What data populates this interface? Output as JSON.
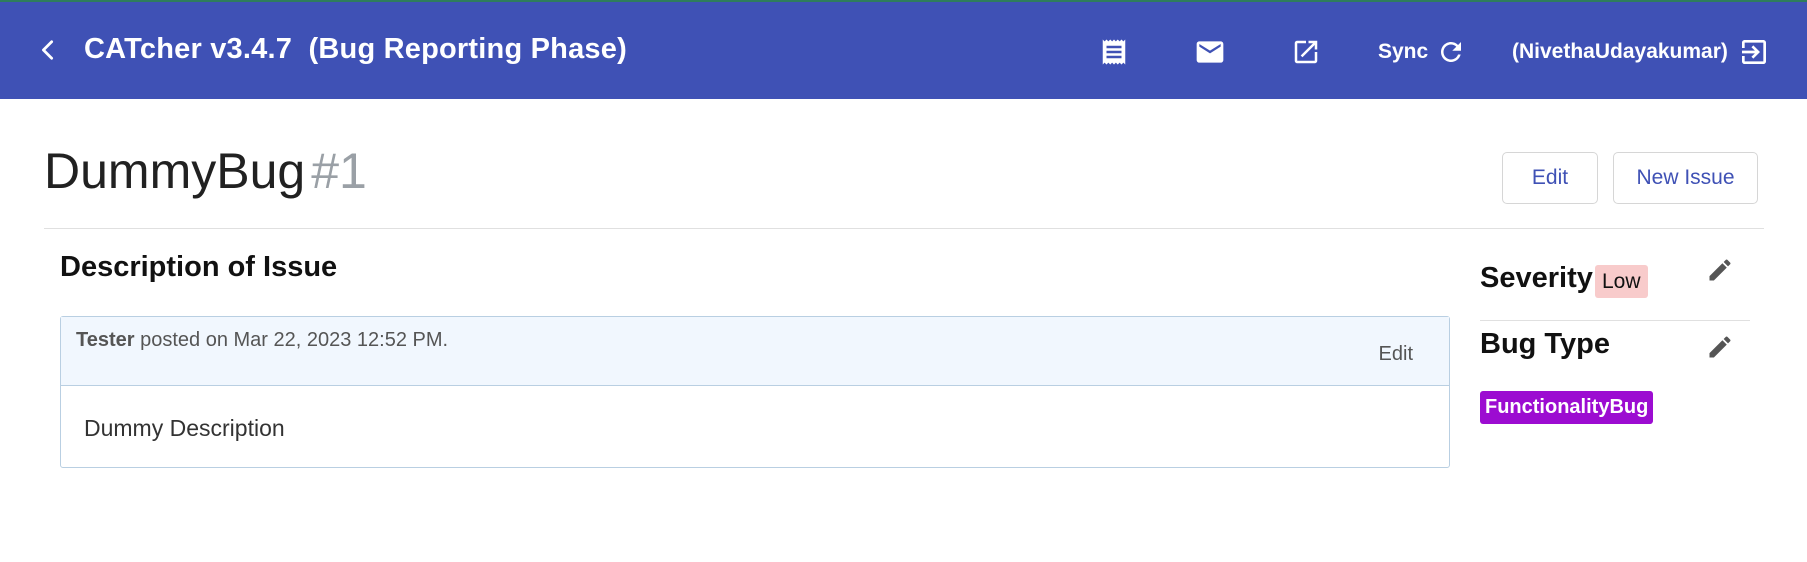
{
  "header": {
    "app_title": "CATcher v3.4.7  (Bug Reporting Phase)",
    "icons": [
      "back-arrow-icon",
      "receipt-icon",
      "mail-icon",
      "open-in-new-icon",
      "refresh-icon",
      "logout-icon"
    ],
    "sync_label": "Sync",
    "user_label": "(NivethaUdayakumar)",
    "bg_color": "#3f51b5"
  },
  "issue": {
    "title": "DummyBug",
    "number": "#1",
    "edit_label": "Edit",
    "new_issue_label": "New Issue"
  },
  "description": {
    "heading": "Description of Issue",
    "author": "Tester",
    "posted_text": " posted on Mar 22, 2023 12:52 PM.",
    "edit_label": "Edit",
    "body": "Dummy Description"
  },
  "sidebar": {
    "severity_label": "Severity",
    "severity_value": "Low",
    "severity_color": "#f8cbcb",
    "bug_type_label": "Bug Type",
    "bug_type_value": "FunctionalityBug",
    "bug_type_color": "#9c0cd1"
  }
}
